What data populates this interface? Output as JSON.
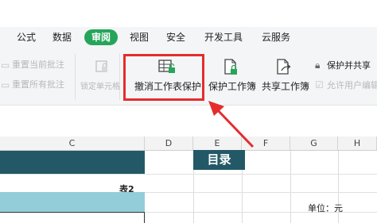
{
  "menu": {
    "items": [
      "公式",
      "数据",
      "审阅",
      "视图",
      "安全",
      "开发工具",
      "云服务"
    ],
    "active": "审阅",
    "active_color": "#26a55a"
  },
  "ribbon": {
    "comment_prev": "重置当前批注",
    "comment_all": "重置所有批注",
    "lock_cell": "锁定单元格",
    "unprotect_sheet": "撤消工作表保护",
    "protect_workbook": "保护工作簿",
    "share_workbook": "共享工作簿",
    "protect_share": "保护并共享",
    "allow_edit": "允许用户编辑"
  },
  "sheet": {
    "columns": [
      "C",
      "D",
      "E",
      "F",
      "G",
      "H"
    ],
    "title_cell": "目录",
    "table_label": "表2",
    "unit_label": "单位：元",
    "header_color": "#235966",
    "light_color": "#93cdd9"
  },
  "annotation": {
    "highlight_color": "#e52c2c"
  }
}
